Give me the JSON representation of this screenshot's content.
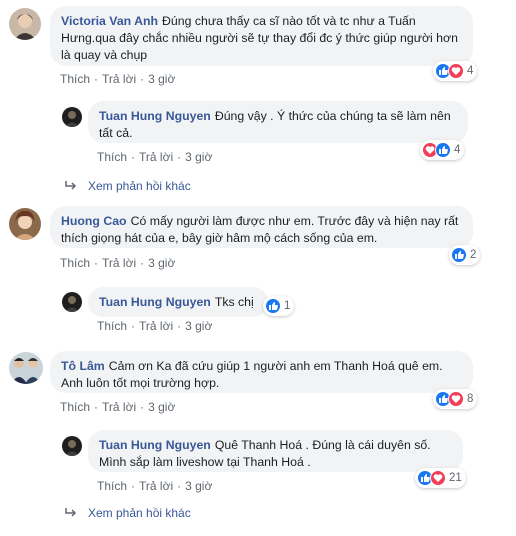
{
  "comments": [
    {
      "author": "Victoria Van Anh",
      "text": "Đúng chưa thấy ca sĩ nào tốt và tc như a Tuấn Hưng.qua đây chắc nhiều người sẽ tự thay đổi đc ý thức giúp người hơn là quay và chụp",
      "like": "Thích",
      "reply": "Trả lời",
      "time": "3 giờ",
      "reactions": [
        "like",
        "love"
      ],
      "count": "4"
    },
    {
      "author": "Tuan Hung Nguyen",
      "text": "Đúng vậy . Ý thức của chúng ta sẽ làm nên tất cả.",
      "like": "Thích",
      "reply": "Trả lời",
      "time": "3 giờ",
      "reactions": [
        "love",
        "like"
      ],
      "count": "4"
    },
    {
      "author": "Huong Cao",
      "text": "Có mấy người làm được như em. Trước đây và hiện nay rất thích giọng hát của e, bây giờ hâm mộ cách sống của em.",
      "like": "Thích",
      "reply": "Trả lời",
      "time": "3 giờ",
      "reactions": [
        "like"
      ],
      "count": "2"
    },
    {
      "author": "Tuan Hung Nguyen",
      "text": "Tks chị",
      "like": "Thích",
      "reply": "Trả lời",
      "time": "3 giờ",
      "reactions": [
        "like"
      ],
      "count": "1"
    },
    {
      "author": "Tô Lâm",
      "text": "Cảm ơn Ka đã cứu giúp 1 người anh em Thanh Hoá quê em. Anh luôn tốt mọi trường hợp.",
      "like": "Thích",
      "reply": "Trả lời",
      "time": "3 giờ",
      "reactions": [
        "like",
        "love"
      ],
      "count": "8"
    },
    {
      "author": "Tuan Hung Nguyen",
      "text": "Quê Thanh Hoá . Đúng là cái duyên số. Mình sắp làm liveshow tại Thanh Hoá .",
      "like": "Thích",
      "reply": "Trả lời",
      "time": "3 giờ",
      "reactions": [
        "like",
        "love"
      ],
      "count": "21"
    }
  ],
  "more_replies_1": "Xem phản hồi khác",
  "more_replies_2": "Xem phản hồi khác",
  "colors": {
    "link": "#385898",
    "bubble": "#f2f3f5",
    "like": "#1877f2",
    "love": "#f33e58"
  }
}
